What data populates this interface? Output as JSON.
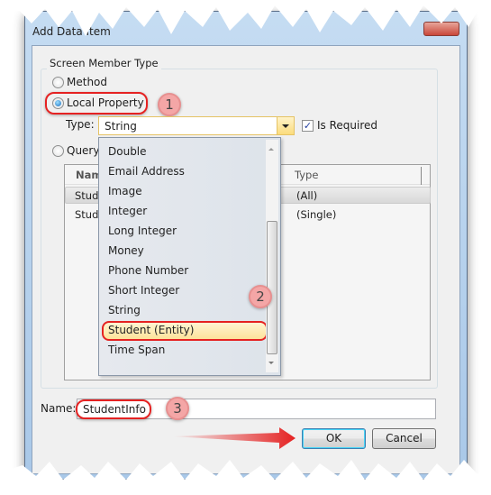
{
  "window": {
    "title": "Add Data Item"
  },
  "group": {
    "label": "Screen Member Type"
  },
  "radios": {
    "method": "Method",
    "local_property": "Local Property",
    "query": "Query",
    "selected": "Local Property"
  },
  "type": {
    "label": "Type:",
    "value": "String",
    "is_required_label": "Is Required",
    "is_required": true
  },
  "grid": {
    "headers": [
      "Nam",
      "Type"
    ],
    "rows": [
      [
        "Stude",
        "(All)"
      ],
      [
        "Stude",
        "(Single)"
      ]
    ]
  },
  "dropdown": {
    "items": [
      "Double",
      "Email Address",
      "Image",
      "Integer",
      "Long Integer",
      "Money",
      "Phone Number",
      "Short Integer",
      "String",
      "Student (Entity)",
      "Time Span"
    ],
    "highlighted": "Student (Entity)"
  },
  "name": {
    "label": "Name:",
    "value": "StudentInfo"
  },
  "buttons": {
    "ok": "OK",
    "cancel": "Cancel"
  },
  "callouts": [
    "1",
    "2",
    "3"
  ],
  "colors": {
    "highlight": "#e52222",
    "selection": "#fde39a"
  }
}
